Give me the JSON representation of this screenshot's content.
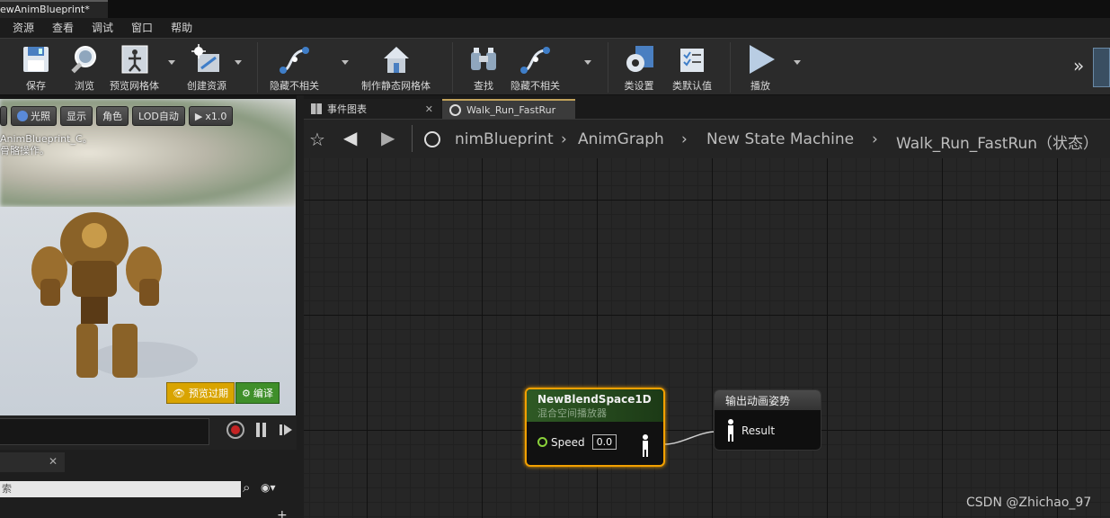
{
  "window": {
    "title": "ewAnimBlueprint*"
  },
  "menu": [
    "资源",
    "查看",
    "调试",
    "窗口",
    "帮助"
  ],
  "toolbar": {
    "save": "保存",
    "browse": "浏览",
    "preview_mesh": "预览网格体",
    "create_asset": "创建资源",
    "hide_unrelated": "隐藏不相关",
    "make_static_mesh": "制作静态网格体",
    "find": "查找",
    "hide_unrelated_2": "隐藏不相关",
    "class_settings": "类设置",
    "class_defaults": "类默认值",
    "play": "播放"
  },
  "viewport": {
    "buttons": {
      "lit": "光照",
      "show": "显示",
      "character": "角色",
      "lod": "LOD自动",
      "speed": "x1.0"
    },
    "info_line1": "AnimBlueprint_C。",
    "info_line2": "骨骼操作。",
    "preview_expired": "预览过期",
    "compile": "编译"
  },
  "search": {
    "placeholder": "索"
  },
  "tabs": {
    "event_graph": "事件图表",
    "state_tab": "Walk_Run_FastRur"
  },
  "breadcrumb": {
    "part1": "nimBlueprint",
    "part2": "AnimGraph",
    "part3": "New State Machine",
    "part4": "Walk_Run_FastRun（状态）"
  },
  "nodes": {
    "blend": {
      "title": "NewBlendSpace1D",
      "subtitle": "混合空间播放器",
      "pin_label": "Speed",
      "pin_value": "0.0"
    },
    "output": {
      "title": "输出动画姿势",
      "pin_label": "Result"
    }
  },
  "watermark": "CSDN @Zhichao_97",
  "colors": {
    "node_selected": "#f2a000",
    "blend_header": "#2f5a25",
    "pin_green": "#8ad13a"
  }
}
